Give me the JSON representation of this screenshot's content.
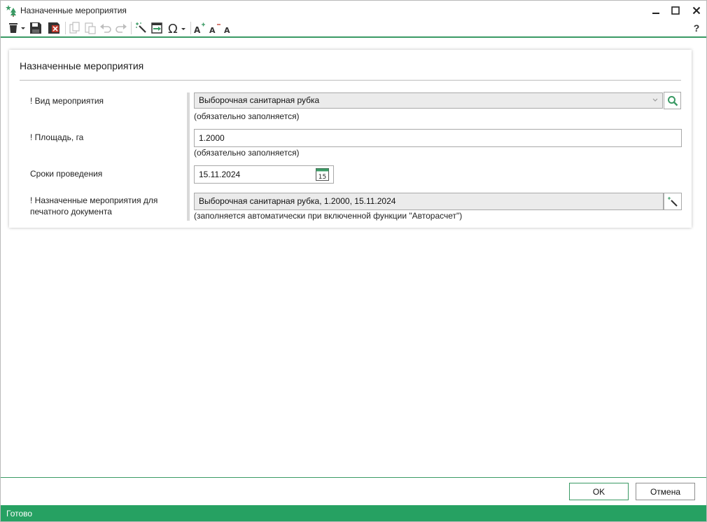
{
  "window": {
    "title": "Назначенные мероприятия",
    "icon": "tree-star-icon"
  },
  "toolbar": {
    "items": [
      "delete-icon",
      "save-icon",
      "save-close-icon",
      "copy-icon",
      "paste-icon",
      "undo-icon",
      "redo-icon",
      "wand-icon",
      "import-icon",
      "omega-icon",
      "font-increase-icon",
      "font-decrease-icon",
      "font-reset-icon",
      "help-icon"
    ],
    "help_label": "?"
  },
  "form": {
    "title": "Назначенные мероприятия",
    "activity_type": {
      "label": "! Вид мероприятия",
      "value": "Выборочная санитарная рубка",
      "hint": "(обязательно заполняется)"
    },
    "area": {
      "label": "! Площадь, га",
      "value": "1.2000",
      "hint": "(обязательно заполняется)"
    },
    "dates": {
      "label": "Сроки проведения",
      "value": "15.11.2024",
      "calendar_day": "15"
    },
    "print_text": {
      "label_line1": "! Назначенные мероприятия для",
      "label_line2": "печатного документа",
      "value": "Выборочная санитарная рубка, 1.2000, 15.11.2024",
      "hint": "(заполняется автоматически при включенной функции \"Авторасчет\")"
    }
  },
  "footer": {
    "ok_label": "OK",
    "cancel_label": "Отмена"
  },
  "status": {
    "text": "Готово"
  },
  "colors": {
    "accent": "#26a162",
    "line": "#3a9a64"
  }
}
